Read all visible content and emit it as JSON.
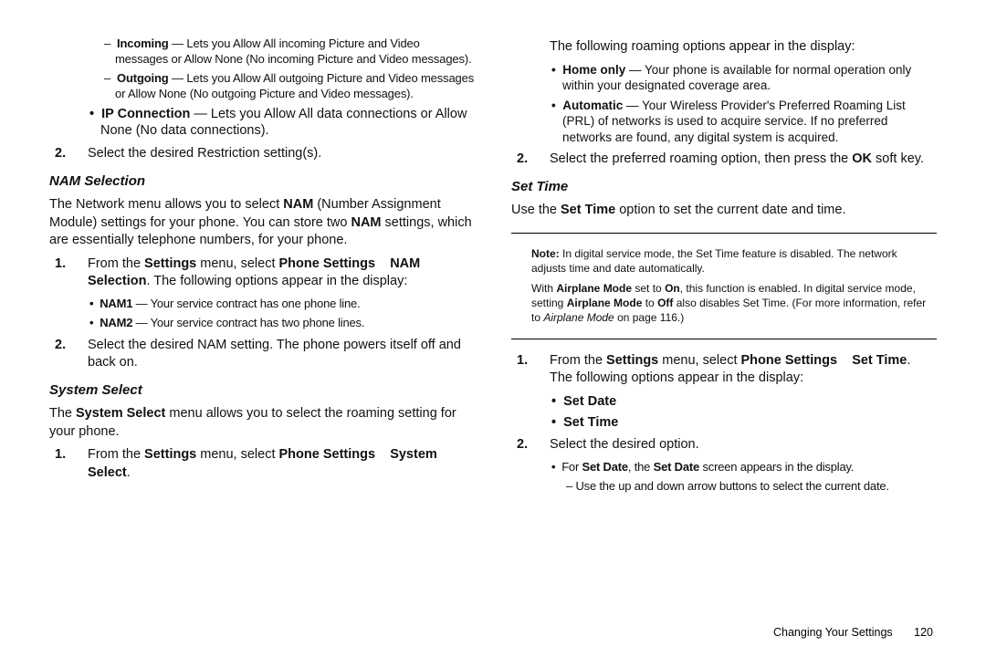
{
  "left": {
    "incoming_label": "Incoming",
    "incoming_text": " — Lets you Allow All incoming Picture and Video messages or Allow None (No incoming Picture and Video messages).",
    "outgoing_label": "Outgoing",
    "outgoing_text": " — Lets you Allow All outgoing Picture and Video messages or Allow None (No outgoing Picture and Video messages).",
    "ipconn_label": "IP Connection",
    "ipconn_text": " — Lets you Allow All data connections or Allow None (No data connections).",
    "step2_restrict": "Select the desired Restriction setting(s).",
    "nam_header": "NAM Selection",
    "nam_intro_a": "The Network menu allows you to select ",
    "nam_intro_b": "NAM",
    "nam_intro_c": " (Number Assignment Module) settings for your phone. You can store two ",
    "nam_intro_d": "NAM",
    "nam_intro_e": " settings, which are essentially telephone numbers, for your phone.",
    "nam_step1_a": "From the ",
    "nam_step1_b": "Settings",
    "nam_step1_c": " menu, select ",
    "nam_step1_d": "Phone Settings",
    "nam_step1_e": "NAM Selection",
    "nam_step1_f": ". The following options appear in the display:",
    "nam1_label": "NAM1",
    "nam1_text": " — Your service contract has one phone line.",
    "nam2_label": "NAM2",
    "nam2_text": " — Your service contract has two phone lines.",
    "nam_step2": "Select the desired NAM setting. The phone powers itself off and back on.",
    "sys_header": "System Select",
    "sys_intro_a": "The ",
    "sys_intro_b": "System Select",
    "sys_intro_c": " menu allows you to select the roaming setting for your phone.",
    "sys_step1_a": "From the ",
    "sys_step1_b": "Settings",
    "sys_step1_c": " menu, select ",
    "sys_step1_d": "Phone Settings",
    "sys_step1_e": "System Select",
    "sys_step1_f": "."
  },
  "right": {
    "roam_intro": "The following roaming options appear in the display:",
    "home_label": "Home only",
    "home_text": " — Your phone is available for normal operation only within your designated coverage area.",
    "auto_label": "Automatic",
    "auto_text": " — Your Wireless Provider's Preferred Roaming List (PRL) of networks is used to acquire service. If no preferred networks are found, any digital system is acquired.",
    "roam_step2_a": "Select the preferred roaming option, then press the ",
    "roam_step2_b": "OK",
    "roam_step2_c": " soft key.",
    "settime_header": "Set Time",
    "settime_intro_a": "Use the ",
    "settime_intro_b": "Set Time",
    "settime_intro_c": " option to set the current date and time.",
    "note_label": "Note:",
    "note_p1_a": " In digital service mode, the Set Time feature is disabled. The network adjusts time and date automatically.",
    "note_p2_a": "With ",
    "note_p2_b": "Airplane Mode",
    "note_p2_c": " set to ",
    "note_p2_d": "On",
    "note_p2_e": ", this function is enabled. In digital service mode, setting ",
    "note_p2_f": "Airplane Mode",
    "note_p2_g": " to ",
    "note_p2_h": "Off",
    "note_p2_i": " also disables Set Time. (For more information, refer to ",
    "note_p2_j": "Airplane Mode",
    "note_p2_k": " on page 116.)",
    "st_step1_a": "From the ",
    "st_step1_b": "Settings",
    "st_step1_c": " menu, select ",
    "st_step1_d": "Phone Settings",
    "st_step1_e": "Set Time",
    "st_step1_f": ". The following options appear in the display:",
    "setdate_label": "Set Date",
    "settime_label": "Set Time",
    "st_step2": "Select the desired option.",
    "setdate_bullet_a": "For ",
    "setdate_bullet_b": "Set Date",
    "setdate_bullet_c": ", the ",
    "setdate_bullet_d": "Set Date",
    "setdate_bullet_e": " screen appears in the display.",
    "setdate_dash": "Use the up and down arrow buttons to select the current date."
  },
  "footer": {
    "section": "Changing Your Settings",
    "page": "120"
  }
}
